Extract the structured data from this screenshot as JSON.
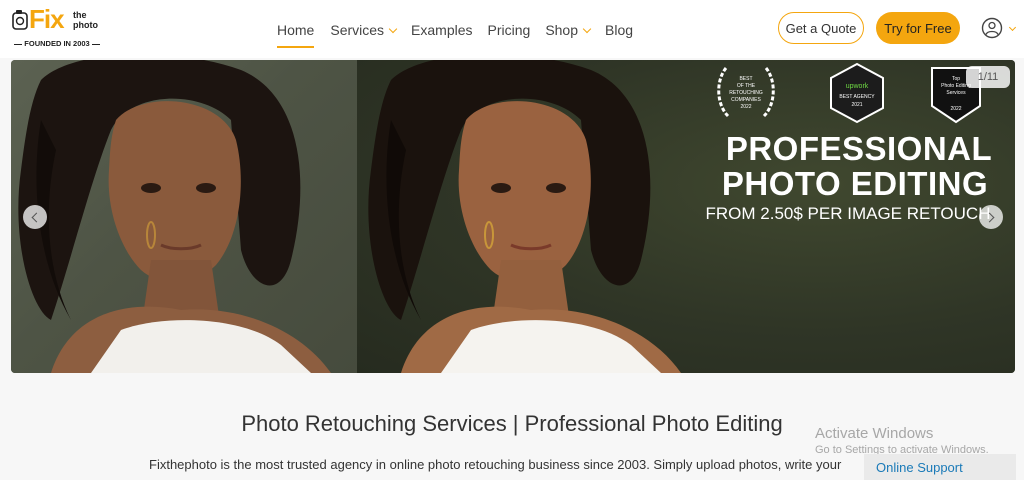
{
  "logo": {
    "brand": "Fix",
    "the": "the",
    "photo": "photo",
    "tagline": "FOUNDED IN 2003"
  },
  "nav": {
    "items": [
      {
        "label": "Home",
        "active": true,
        "dropdown": false
      },
      {
        "label": "Services",
        "active": false,
        "dropdown": true
      },
      {
        "label": "Examples",
        "active": false,
        "dropdown": false
      },
      {
        "label": "Pricing",
        "active": false,
        "dropdown": false
      },
      {
        "label": "Shop",
        "active": false,
        "dropdown": true
      },
      {
        "label": "Blog",
        "active": false,
        "dropdown": false
      }
    ],
    "quote_label": "Get a Quote",
    "try_label": "Try for Free"
  },
  "hero": {
    "counter": "1/11",
    "title_line1": "PROFESSIONAL",
    "title_line2": "PHOTO EDITING",
    "subtitle": "FROM 2.50$ PER IMAGE RETOUCH",
    "badges": [
      {
        "icon": "laurel-award-icon",
        "text": "BEST OF THE RETOUCHING COMPANIES 2022"
      },
      {
        "icon": "upwork-badge-icon",
        "brand": "Upwork",
        "text": "BEST AGENCY 2021"
      },
      {
        "icon": "shield-badge-icon",
        "text": "Top Photo Editing Services 2022"
      }
    ]
  },
  "content": {
    "title": "Photo Retouching Services | Professional Photo Editing",
    "text": "Fixthephoto is the most trusted agency in online photo retouching business since 2003. Simply upload photos, write your"
  },
  "overlay": {
    "windows_title": "Activate Windows",
    "windows_sub": "Go to Settings to activate Windows.",
    "support": "Online Support"
  },
  "colors": {
    "accent": "#f4a60f",
    "link": "#1a7ab8"
  }
}
